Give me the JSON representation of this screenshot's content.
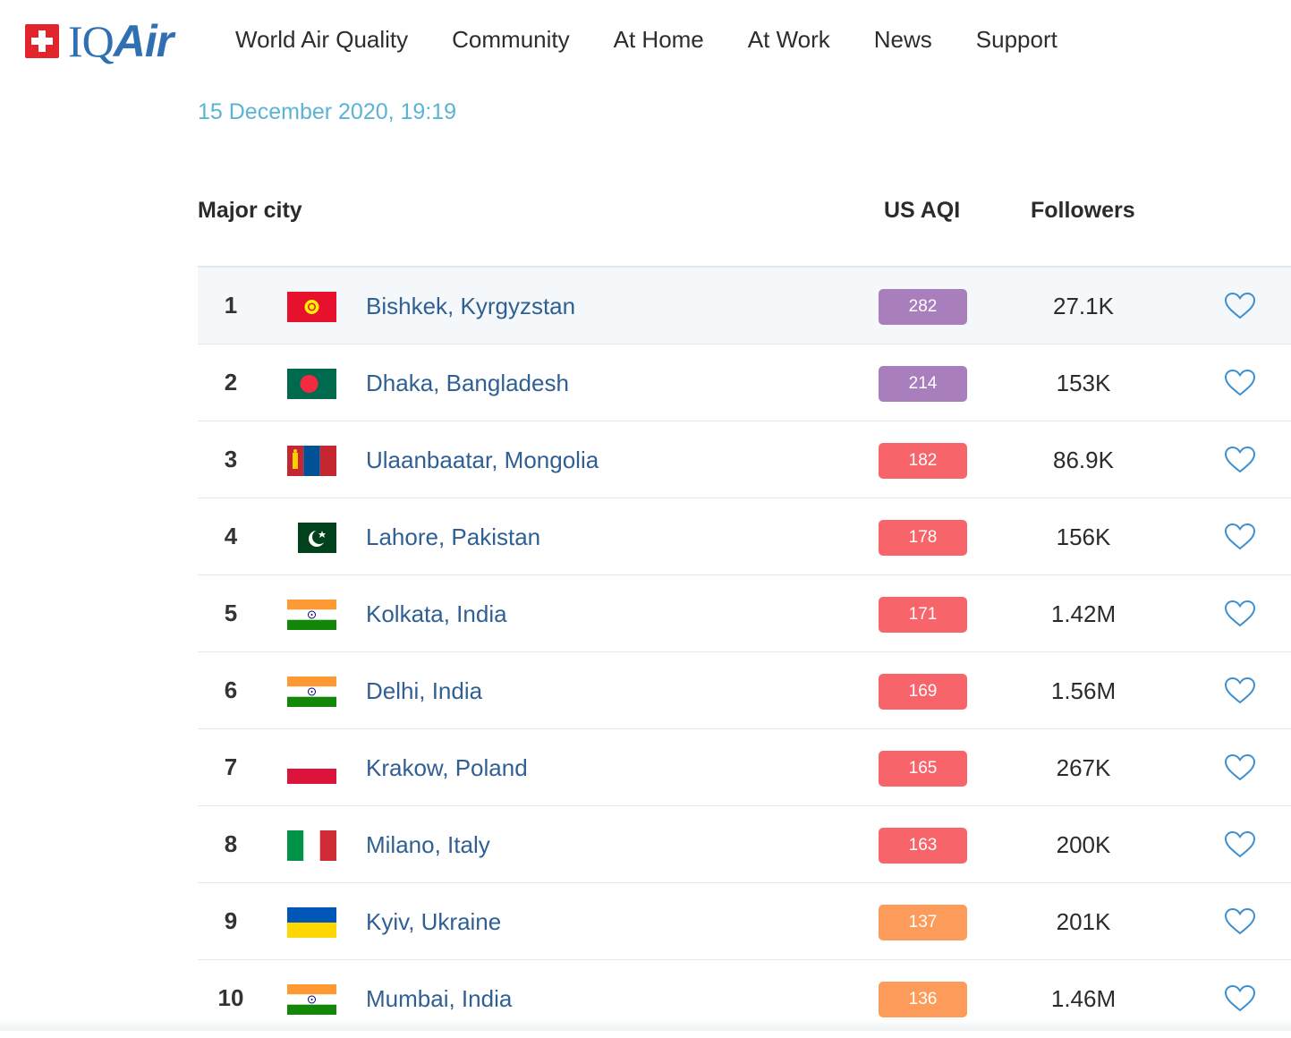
{
  "brand": {
    "logo_iq": "IQ",
    "logo_air": "Air"
  },
  "nav": [
    "World Air Quality",
    "Community",
    "At Home",
    "At Work",
    "News",
    "Support"
  ],
  "timestamp": "15 December 2020, 19:19",
  "table_headers": {
    "city": "Major city",
    "aqi": "US AQI",
    "followers": "Followers"
  },
  "colors": {
    "purple": "#a97ebd",
    "red": "#f7646a",
    "orange": "#fd9b5a",
    "link": "#2f5f93",
    "timestamp": "#5bb3d6"
  },
  "rows": [
    {
      "rank": "1",
      "flag": "kyrgyzstan-flag",
      "city": "Bishkek, Kyrgyzstan",
      "aqi": "282",
      "aqi_color": "#a97ebd",
      "followers": "27.1K"
    },
    {
      "rank": "2",
      "flag": "bangladesh-flag",
      "city": "Dhaka, Bangladesh",
      "aqi": "214",
      "aqi_color": "#a97ebd",
      "followers": "153K"
    },
    {
      "rank": "3",
      "flag": "mongolia-flag",
      "city": "Ulaanbaatar, Mongolia",
      "aqi": "182",
      "aqi_color": "#f7646a",
      "followers": "86.9K"
    },
    {
      "rank": "4",
      "flag": "pakistan-flag",
      "city": "Lahore, Pakistan",
      "aqi": "178",
      "aqi_color": "#f7646a",
      "followers": "156K"
    },
    {
      "rank": "5",
      "flag": "india-flag",
      "city": "Kolkata, India",
      "aqi": "171",
      "aqi_color": "#f7646a",
      "followers": "1.42M"
    },
    {
      "rank": "6",
      "flag": "india-flag",
      "city": "Delhi, India",
      "aqi": "169",
      "aqi_color": "#f7646a",
      "followers": "1.56M"
    },
    {
      "rank": "7",
      "flag": "poland-flag",
      "city": "Krakow, Poland",
      "aqi": "165",
      "aqi_color": "#f7646a",
      "followers": "267K"
    },
    {
      "rank": "8",
      "flag": "italy-flag",
      "city": "Milano, Italy",
      "aqi": "163",
      "aqi_color": "#f7646a",
      "followers": "200K"
    },
    {
      "rank": "9",
      "flag": "ukraine-flag",
      "city": "Kyiv, Ukraine",
      "aqi": "137",
      "aqi_color": "#fd9b5a",
      "followers": "201K"
    },
    {
      "rank": "10",
      "flag": "india-flag",
      "city": "Mumbai, India",
      "aqi": "136",
      "aqi_color": "#fd9b5a",
      "followers": "1.46M"
    }
  ]
}
